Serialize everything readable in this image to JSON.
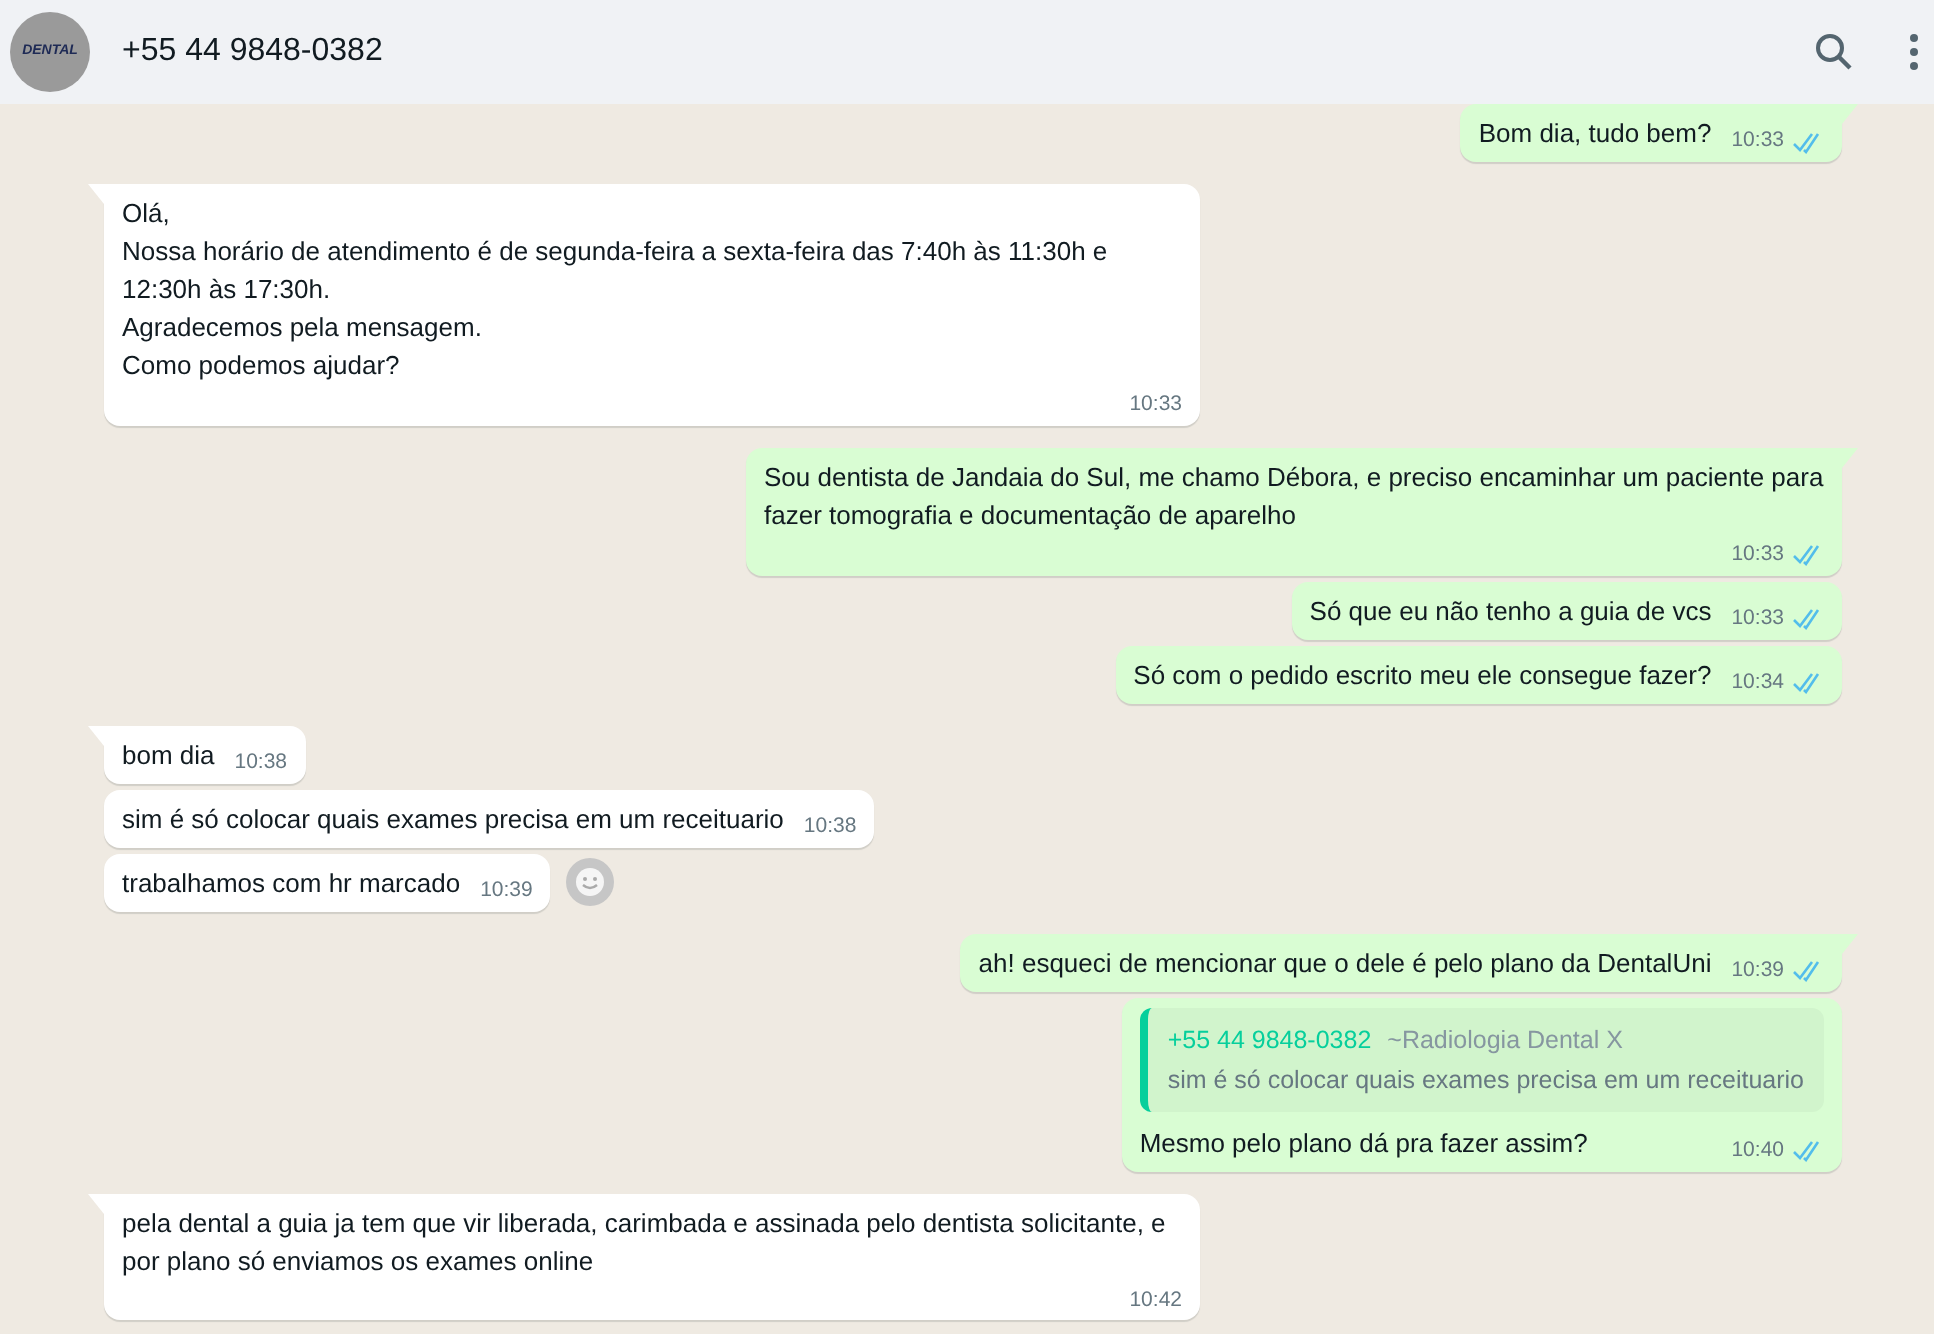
{
  "header": {
    "contact": "+55 44 9848-0382",
    "avatar_text": "DENTAL"
  },
  "messages": [
    {
      "kind": "outgoing",
      "tail": true,
      "text": "Bom dia, tudo bem?",
      "time": "10:33",
      "read": true
    },
    {
      "kind": "incoming",
      "tail": true,
      "text": "Olá,\nNossa horário de atendimento é de segunda-feira a sexta-feira das 7:40h às 11:30h e 12:30h às 17:30h.\nAgradecemos pela mensagem.\nComo podemos ajudar?",
      "time": "10:33"
    },
    {
      "kind": "outgoing",
      "tail": true,
      "text": "Sou dentista de Jandaia do Sul, me chamo Débora, e preciso encaminhar um paciente para fazer tomografia e documentação de aparelho",
      "time": "10:33",
      "read": true
    },
    {
      "kind": "outgoing",
      "tail": false,
      "text": "Só que eu não tenho a guia de vcs",
      "time": "10:33",
      "read": true
    },
    {
      "kind": "outgoing",
      "tail": false,
      "text": "Só com o pedido escrito meu ele consegue fazer?",
      "time": "10:34",
      "read": true
    },
    {
      "kind": "incoming",
      "tail": true,
      "text": "bom dia",
      "time": "10:38"
    },
    {
      "kind": "incoming",
      "tail": false,
      "text": "sim é só colocar quais exames precisa em um receituario",
      "time": "10:38"
    },
    {
      "kind": "incoming",
      "tail": false,
      "text": "trabalhamos com hr marcado",
      "time": "10:39",
      "react_button": true
    },
    {
      "kind": "outgoing",
      "tail": true,
      "text": "ah! esqueci de mencionar que o dele é pelo plano da DentalUni",
      "time": "10:39",
      "read": true
    },
    {
      "kind": "outgoing",
      "tail": false,
      "quote": {
        "author": "+55 44 9848-0382",
        "note": "~Radiologia Dental X",
        "text": "sim é só colocar quais exames precisa em um receituario"
      },
      "text": "Mesmo pelo plano dá pra fazer assim?",
      "time": "10:40",
      "read": true
    },
    {
      "kind": "incoming",
      "tail": true,
      "text": "pela dental a guia ja tem que vir liberada, carimbada e assinada pelo dentista solicitante, e por plano só enviamos os exames online",
      "time": "10:42"
    }
  ]
}
